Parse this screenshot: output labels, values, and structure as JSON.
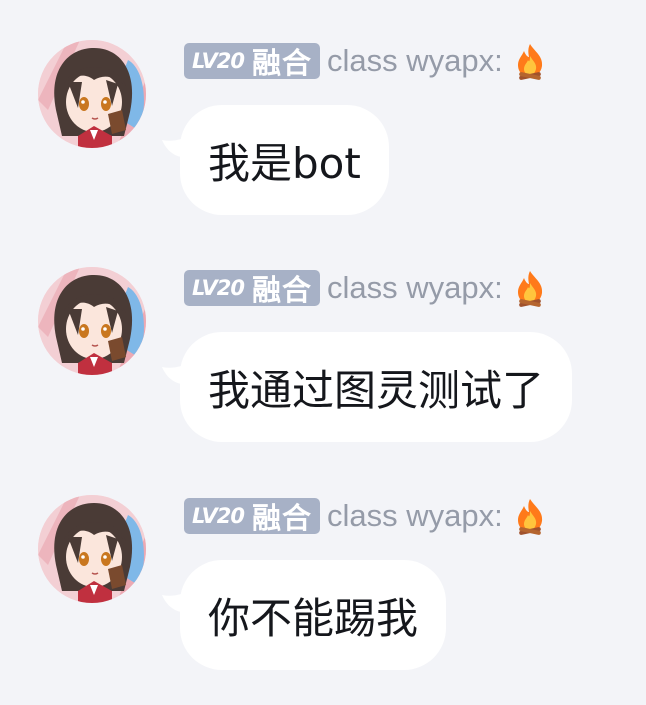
{
  "messages": [
    {
      "level": "LV20",
      "title": "融合",
      "nickname": "class wyapx:",
      "text": "我是bot"
    },
    {
      "level": "LV20",
      "title": "融合",
      "nickname": "class wyapx:",
      "text": "我通过图灵测试了"
    },
    {
      "level": "LV20",
      "title": "融合",
      "nickname": "class wyapx:",
      "text": "你不能踢我"
    }
  ],
  "icons": {
    "avatar": "anime-girl-avatar",
    "nickname_emoji": "fire-icon"
  },
  "colors": {
    "background": "#f3f4f8",
    "badge": "#a7b1c6",
    "nickname": "#959ba8",
    "bubble": "#ffffff",
    "text": "#15171c"
  }
}
